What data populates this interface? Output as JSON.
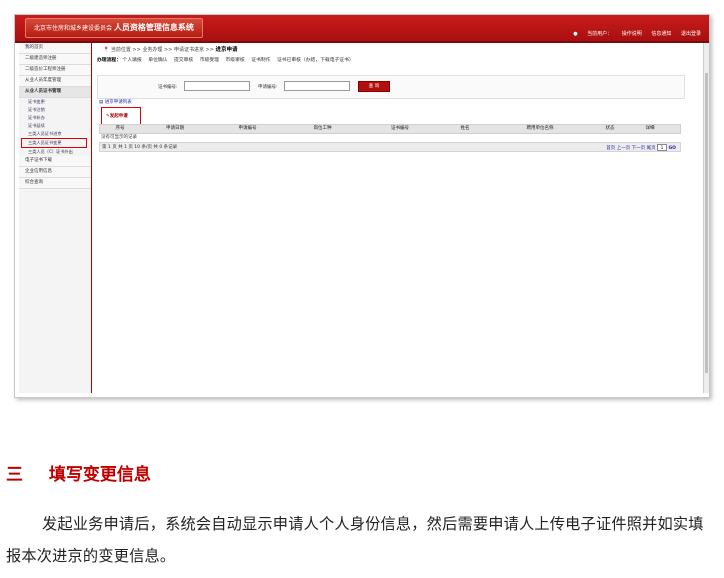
{
  "app": {
    "logo_small": "北京市住房和城乡建设委员会",
    "logo_big": "人员资格管理信息系统",
    "user_label": "当前用户：",
    "toplinks": [
      "操作说明",
      "信息通知",
      "退出登录"
    ]
  },
  "sidebar": {
    "items_top": [
      "我的首页",
      "二级建造师注册",
      "二级造价工程师注册",
      "从业人员年度管理"
    ],
    "section_head": "从业人员证书管理",
    "sub_items": [
      "证书变更",
      "证书注销",
      "证书补办",
      "证书延续",
      "三类人员证书进京",
      "三类人员证书变更",
      "三类人员〔C〕证书外出"
    ],
    "highlighted_sub": "三类人员证书进京",
    "items_bottom": [
      "电子证书下载",
      "企业信用信息",
      "综合查询"
    ]
  },
  "main": {
    "breadcrumb": "当前位置 >> 业务办理 >> 申请证书进京 >>",
    "breadcrumb_current": "进京申请",
    "flow_label": "办理流程：",
    "flow_steps": [
      "个人填报",
      "单位确认",
      "提交审核",
      "市级受理",
      "市级审核",
      "证书制作",
      "证书已审核（办结，下载电子证书）"
    ],
    "search": {
      "label_cert": "证书编号:",
      "label_apply": "申请编号:",
      "query_button": "查 询"
    },
    "list_link": "进京申请列表",
    "start_button": "发起申请",
    "table_headers": [
      "序号",
      "申请日期",
      "申请编号",
      "岗位工种",
      "证书编号",
      "姓名",
      "聘用单位名称",
      "状态",
      "详细"
    ],
    "no_records": "没有可显示的记录",
    "pager_left": "第 1 页  共 1 页  10 条/页  共 0 条记录",
    "pager_right": "首页 上一页 下一页 尾页",
    "page_input": "1",
    "go_label": "GO"
  },
  "article": {
    "number": "三",
    "title": "填写变更信息",
    "paragraph": "发起业务申请后，系统会自动显示申请人个人身份信息，然后需要申请人上传电子证件照并如实填报本次进京的变更信息。"
  },
  "colors": {
    "brand_red": "#b01010",
    "heading_red": "#c00000",
    "highlight_border": "#e00000"
  }
}
